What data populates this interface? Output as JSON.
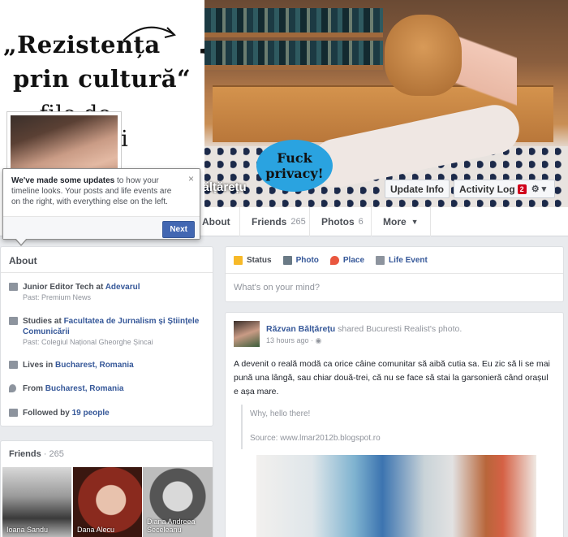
{
  "cover": {
    "handwritten_line1": "„Rezistența",
    "handwritten_line2": "prin cultură“",
    "handwritten_line3": "- file de generații",
    "sign_text": "Fuck privacy!",
    "profile_name": "Răzvan Bălțărețu"
  },
  "cover_actions": {
    "update_info": "Update Info",
    "activity_log": "Activity Log",
    "activity_count": "2"
  },
  "nav": {
    "about": "About",
    "friends": "Friends",
    "friends_count": "265",
    "photos": "Photos",
    "photos_count": "6",
    "more": "More"
  },
  "tooltip": {
    "bold": "We've made some updates",
    "text": " to how your timeline looks. Your posts and life events are on the right, with everything else on the left.",
    "next": "Next"
  },
  "about": {
    "title": "About",
    "work_role": "Junior Editor Tech at ",
    "work_place": "Adevarul",
    "work_past": "Past: Premium News",
    "study_prefix": "Studies at ",
    "study_place": "Facultatea de Jurnalism și Științele Comunicării",
    "study_past": "Past: Colegiul Național Gheorghe Șincai",
    "lives_prefix": "Lives in ",
    "lives_place": "Bucharest, Romania",
    "from_prefix": "From ",
    "from_place": "Bucharest, Romania",
    "followed_prefix": "Followed by ",
    "followed_count": "19 people"
  },
  "friends": {
    "title": "Friends",
    "count": " · 265",
    "items": [
      {
        "name": "Ioana Sandu"
      },
      {
        "name": "Dana Alecu"
      },
      {
        "name": "Diana Andreea Seceleanu"
      }
    ]
  },
  "composer": {
    "status": "Status",
    "photo": "Photo",
    "place": "Place",
    "life_event": "Life Event",
    "placeholder": "What's on your mind?"
  },
  "post": {
    "author": "Răzvan Bălțărețu",
    "action": " shared Bucuresti Realist's photo.",
    "time": "13 hours ago",
    "text": "A devenit o reală modă ca orice câine comunitar să aibă cutia sa. Eu zic să li se mai pună una lângă, sau chiar două-trei, că nu se face să stai la garsonieră când orașul e așa mare.",
    "quote_line1": "Why, hello there!",
    "quote_line2": "Source: www.lmar2012b.blogspot.ro"
  },
  "colors": {
    "link": "#365899",
    "button_blue": "#4267b2",
    "badge_red": "#d0021b",
    "sign_blue": "#2aa3e0"
  }
}
